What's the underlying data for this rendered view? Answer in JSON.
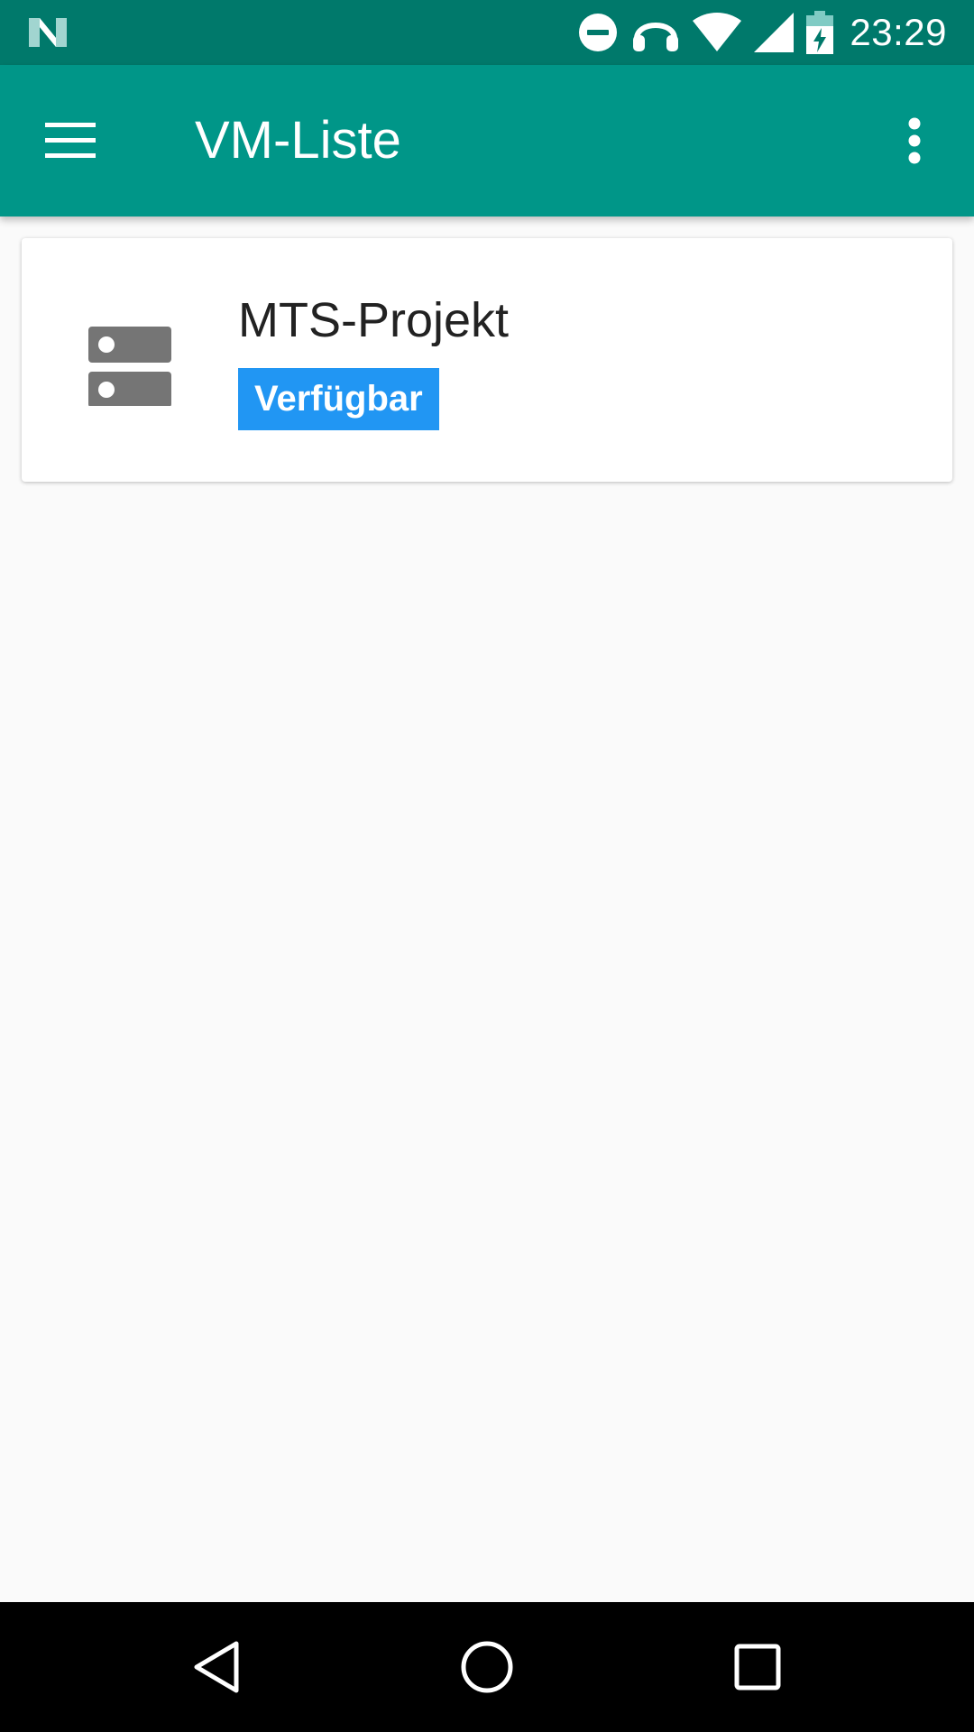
{
  "status_bar": {
    "time": "23:29",
    "icons": [
      "notification-n-icon",
      "do-not-disturb-icon",
      "headphones-icon",
      "wifi-icon",
      "cell-signal-icon",
      "battery-charging-icon"
    ]
  },
  "app_bar": {
    "title": "VM-Liste",
    "icons": [
      "menu-icon",
      "more-vert-icon"
    ]
  },
  "vm_list": [
    {
      "name": "MTS-Projekt",
      "status": "Verfügbar",
      "icon": "server-icon"
    }
  ],
  "nav_bar": {
    "icons": [
      "back-icon",
      "home-icon",
      "recents-icon"
    ]
  },
  "colors": {
    "status_bar": "#00796b",
    "app_bar": "#009688",
    "badge": "#2196f3",
    "background": "#fafafa",
    "nav_bar": "#000000"
  }
}
